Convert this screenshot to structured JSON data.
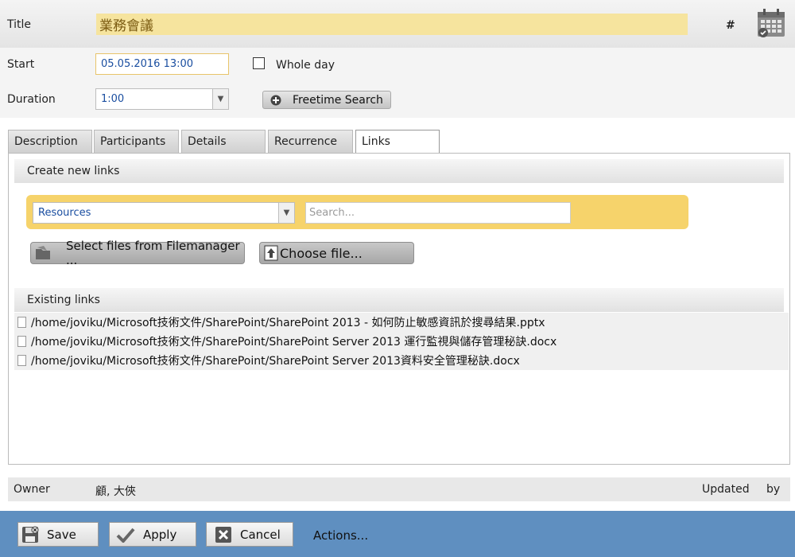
{
  "header": {
    "title_label": "Title",
    "title_value": "業務會議",
    "hash": "#"
  },
  "form": {
    "start_label": "Start",
    "start_value": "05.05.2016 13:00",
    "whole_day_label": "Whole day",
    "whole_day_checked": false,
    "duration_label": "Duration",
    "duration_value": "1:00",
    "freetime_label": "Freetime Search"
  },
  "tabs": [
    {
      "label": "Description",
      "active": false
    },
    {
      "label": "Participants",
      "active": false
    },
    {
      "label": "Details",
      "active": false
    },
    {
      "label": "Recurrence",
      "active": false
    },
    {
      "label": "Links",
      "active": true
    }
  ],
  "links_panel": {
    "create_heading": "Create new links",
    "resource_select": "Resources",
    "search_placeholder": "Search...",
    "filemanager_label": "Select files from Filemanager ...",
    "choose_file_label": "Choose file...",
    "existing_heading": "Existing links",
    "existing_links": [
      "/home/joviku/Microsoft技術文件/SharePoint/SharePoint 2013 - 如何防止敏感資訊於搜尋結果.pptx",
      "/home/joviku/Microsoft技術文件/SharePoint/SharePoint Server 2013 運行監視與儲存管理秘訣.docx",
      "/home/joviku/Microsoft技術文件/SharePoint/SharePoint Server 2013資料安全管理秘訣.docx"
    ]
  },
  "owner_bar": {
    "owner_label": "Owner",
    "owner_value": "顧, 大俠",
    "updated_label": "Updated",
    "by_label": "by"
  },
  "actions": {
    "save_label": "Save",
    "apply_label": "Apply",
    "cancel_label": "Cancel",
    "more_label": "Actions..."
  },
  "colors": {
    "title_highlight": "#f6e49e",
    "search_strip": "#f6d36b",
    "bottom_bar": "#5f8fc0"
  },
  "icons": {
    "calendar": "calendar-icon",
    "freetime": "plus-circle-icon",
    "filemanager": "folder-icon",
    "choose_file": "upload-icon",
    "save": "save-icon",
    "apply": "check-icon",
    "cancel": "close-icon"
  }
}
